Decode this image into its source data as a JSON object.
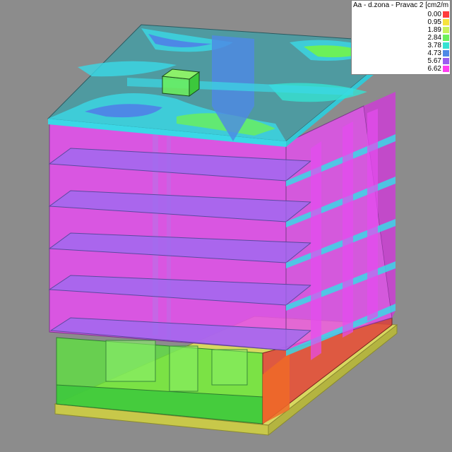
{
  "legend": {
    "title": "Aa - d.zona - Pravac 2 [cm2/m",
    "items": [
      {
        "value": "0.00",
        "color": "#ff3b3b"
      },
      {
        "value": "0.95",
        "color": "#f6e23c"
      },
      {
        "value": "1.89",
        "color": "#c8f25a"
      },
      {
        "value": "2.84",
        "color": "#6cf05a"
      },
      {
        "value": "3.78",
        "color": "#35e2d2"
      },
      {
        "value": "4.73",
        "color": "#4d88e6"
      },
      {
        "value": "5.67",
        "color": "#9a5cf0"
      },
      {
        "value": "6.62",
        "color": "#ff3cf0"
      }
    ]
  },
  "colors": {
    "background": "#8c8c8c",
    "wall_magenta": "#e64cf0",
    "slab_violet": "#9a6cf0",
    "slab_cyan": "#3ad8e6",
    "basement_green": "#5ce63c",
    "foundation_yellow": "#e0e06a",
    "wall_red": "#f04a30"
  }
}
